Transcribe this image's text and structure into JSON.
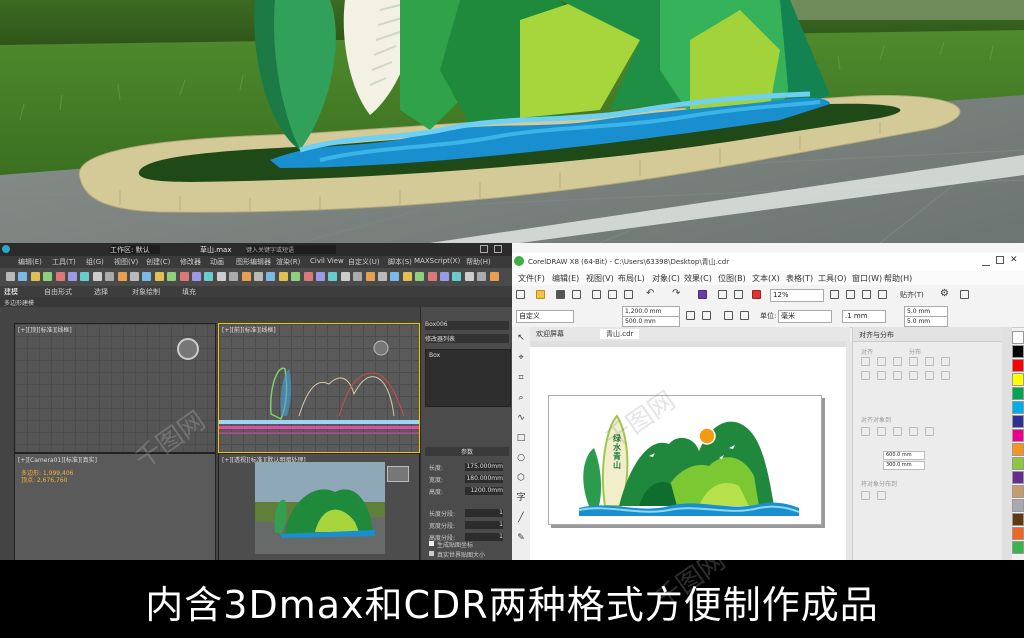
{
  "max_window": {
    "title": "草山.max",
    "search_placeholder": "键入关键字或短语",
    "workspace": "工作区: 默认",
    "menus": [
      "编辑(E)",
      "工具(T)",
      "组(G)",
      "视图(V)",
      "创建(C)",
      "修改器",
      "动画",
      "图形编辑器",
      "渲染(R)",
      "Civil View",
      "自定义(U)",
      "脚本(S)",
      "MAXScript(X)",
      "帮助(H)"
    ],
    "ribbon_tabs": [
      "建模",
      "自由形式",
      "选择",
      "对象绘制",
      "填充"
    ],
    "sub_label": "多边形建模",
    "viewports": {
      "top_left": "[+][顶][标准][线框]",
      "top_right": "[+][前][标准][线框]",
      "bottom_left": "[+][Camera01][标准][真实]",
      "bottom_right": "[+][透视][标准][默认明暗处理]"
    },
    "camera_readout": [
      "多边形: 1,999,406",
      "顶点: 2,676,760"
    ],
    "command_panel": {
      "object_name": "Box006",
      "modifier_list": "修改器列表",
      "stack_item": "Box",
      "rollout_title": "参数",
      "fields": [
        {
          "label": "长度:",
          "value": "175.000mm"
        },
        {
          "label": "宽度:",
          "value": "180.000mm"
        },
        {
          "label": "高度:",
          "value": "1200.0mm"
        },
        {
          "label": "长度分段:",
          "value": "1"
        },
        {
          "label": "宽度分段:",
          "value": "1"
        },
        {
          "label": "高度分段:",
          "value": "1"
        }
      ],
      "checkbox_1": "生成贴图坐标",
      "checkbox_2": "真实世界贴图大小"
    }
  },
  "cdr_window": {
    "title": "CorelDRAW X8 (64-Bit) - C:\\Users\\63398\\Desktop\\青山.cdr",
    "menus": [
      "文件(F)",
      "编辑(E)",
      "视图(V)",
      "布局(L)",
      "对象(C)",
      "效果(C)",
      "位图(B)",
      "文本(X)",
      "表格(T)",
      "工具(O)",
      "窗口(W)",
      "帮助(H)"
    ],
    "zoom": "12%",
    "snap": "贴齐(T)",
    "page_preset": "自定义",
    "page_width": "1,200.0 mm",
    "page_height": "500.0 mm",
    "unit_label": "单位:",
    "unit_value": "毫米",
    "nudge": ".1 mm",
    "dup_x": "5.0 mm",
    "dup_y": "5.0 mm",
    "tabs": [
      "欢迎屏幕",
      "青山.cdr"
    ],
    "artwork_text": "绿水青山",
    "docker": {
      "title": "对齐与分布",
      "section_1": "对齐",
      "section_2": "分布",
      "section_3": "对齐对象到",
      "section_4": "将对象分布到",
      "x_value": "600.0 mm",
      "y_value": "300.0 mm"
    },
    "palette_colors": [
      "#ffffff",
      "#000000",
      "#ff0000",
      "#ffff00",
      "#00a651",
      "#00aeef",
      "#2e3192",
      "#ec008c",
      "#f7941d",
      "#8dc63f",
      "#662d91",
      "#c69c6d",
      "#a7a9ac",
      "#603913",
      "#f26522",
      "#39b54a"
    ]
  },
  "caption": "内含3Dmax和CDR两种格式方便制作成品",
  "watermarks": [
    "千图网",
    "千图网",
    "千图网"
  ]
}
